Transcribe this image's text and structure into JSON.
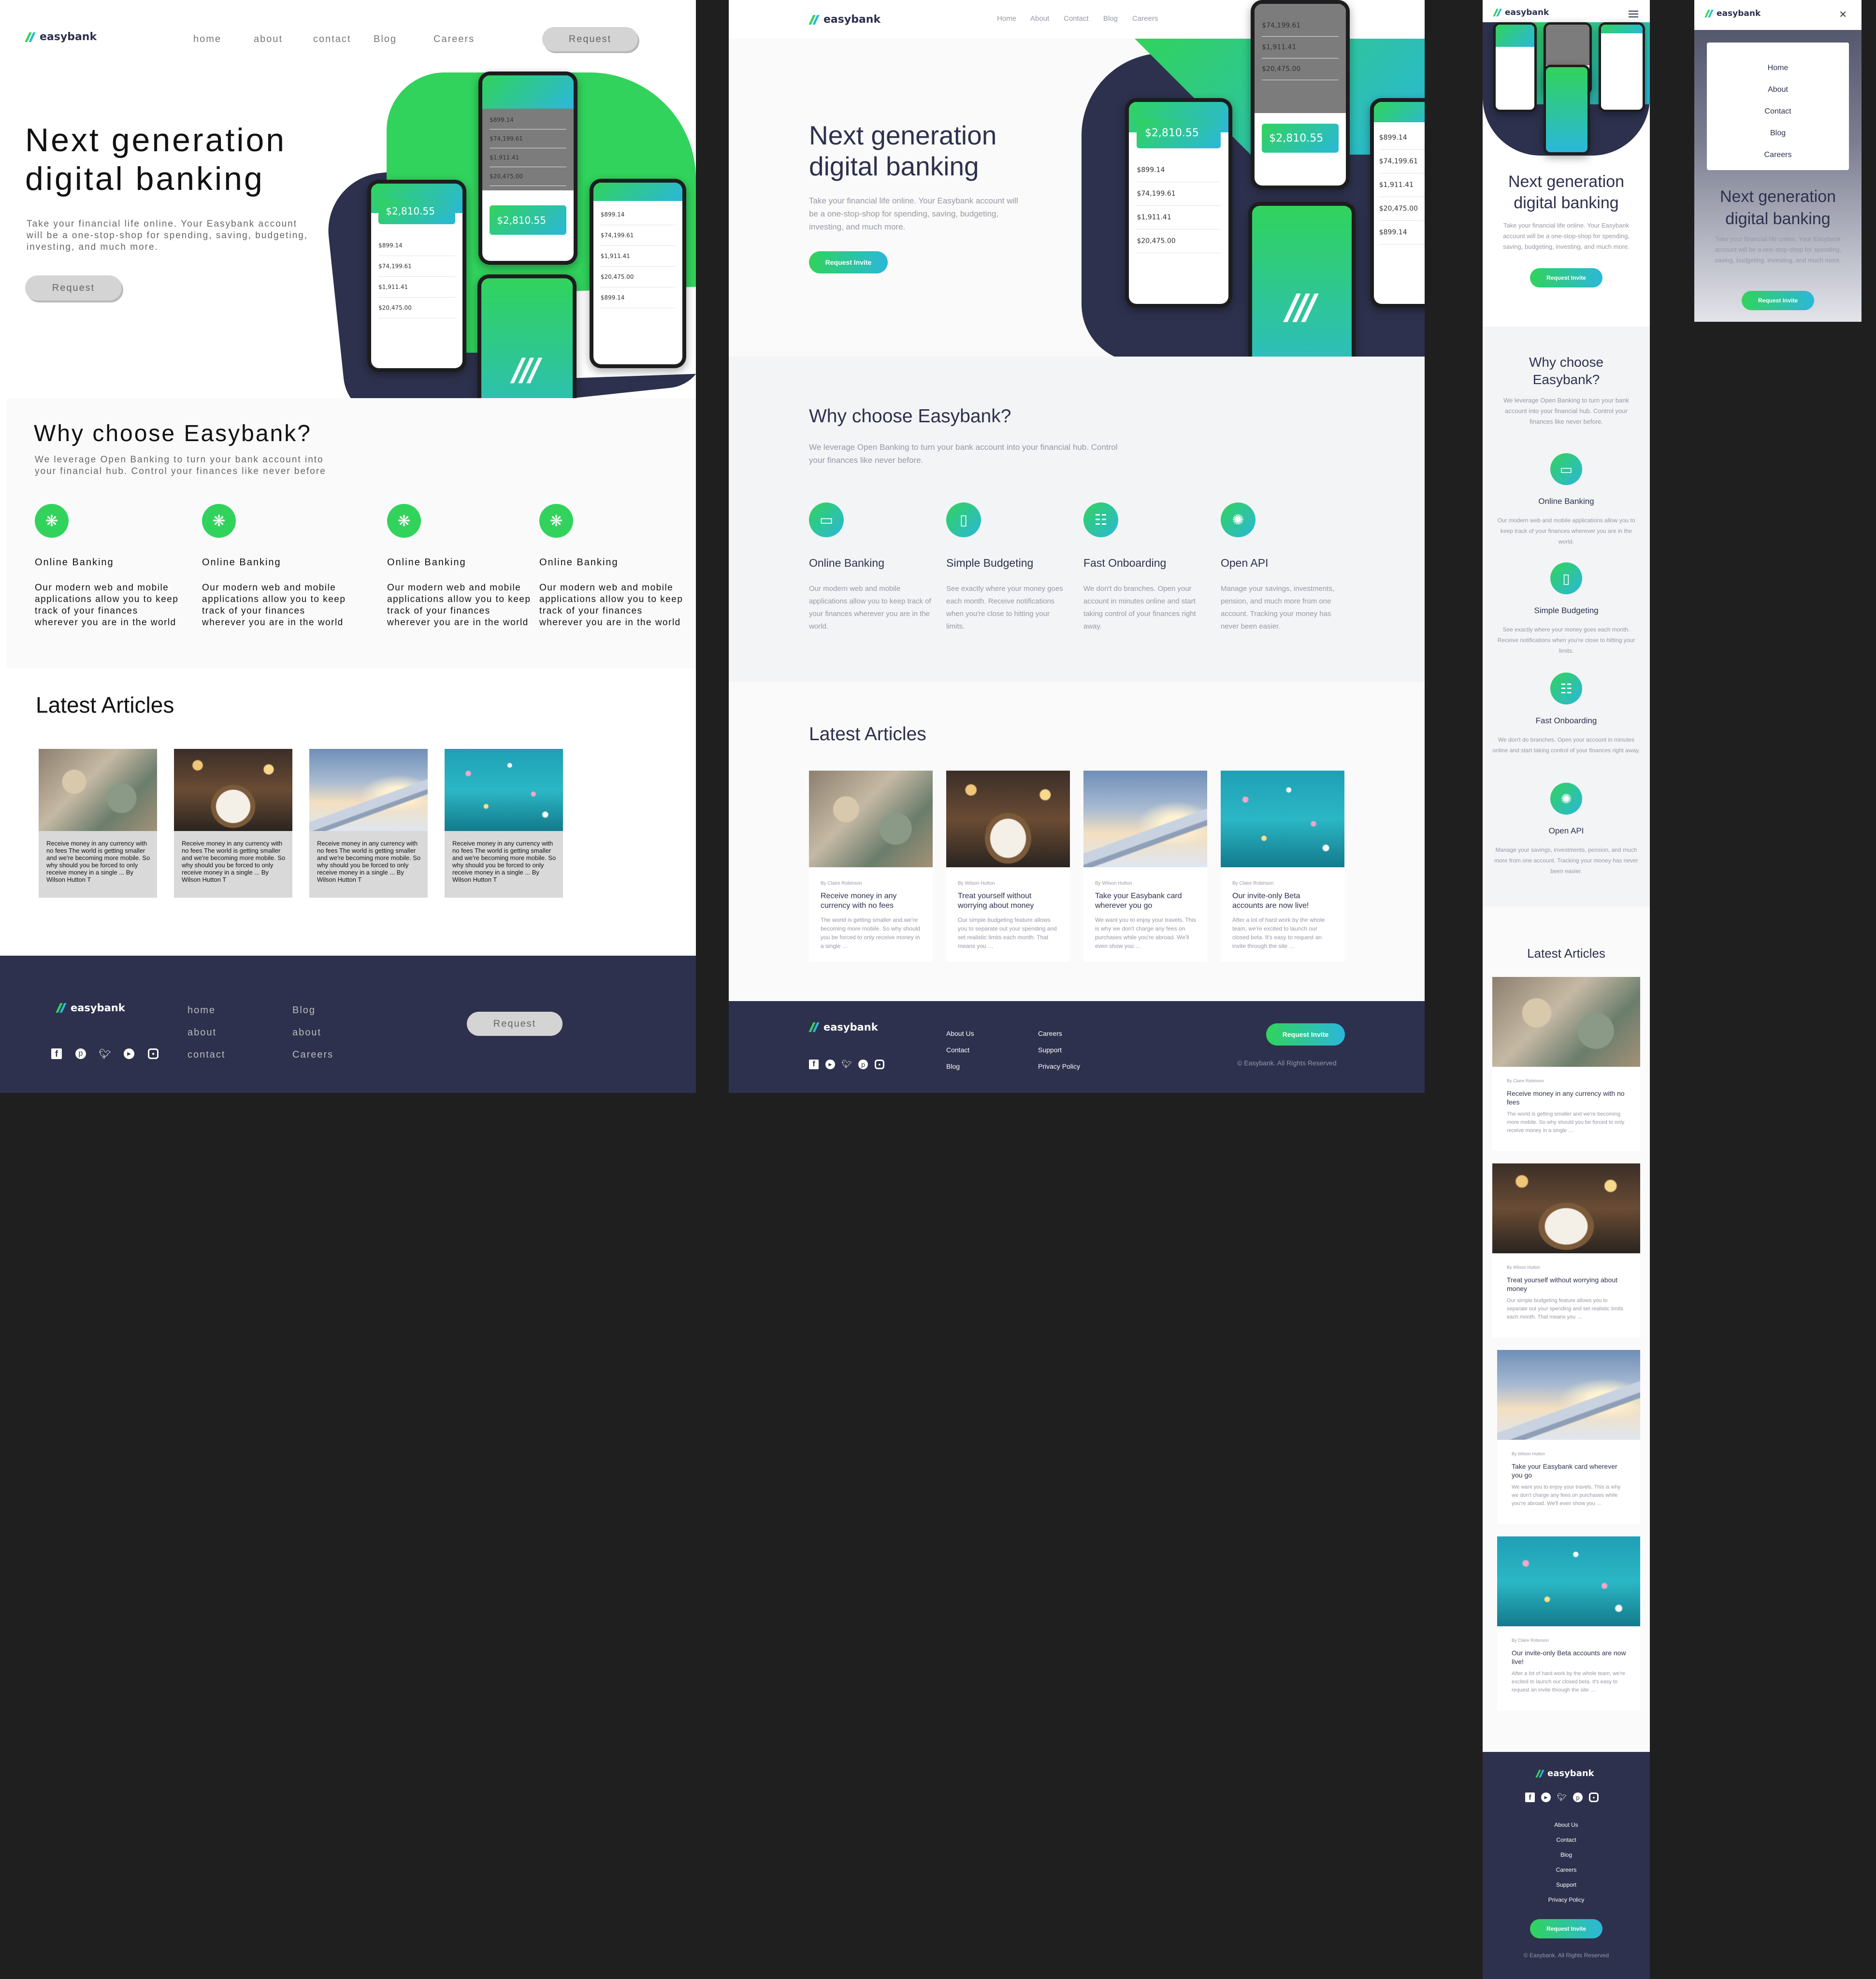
{
  "brand": "easybank",
  "hero": {
    "title_line1": "Next generation",
    "title_line2": "digital banking",
    "text_a": "Take your financial life online. Your Easybank account will be a one-stop-shop for spending, saving, budgeting, investing, and much more.",
    "text_b": "Take your financial life online. Your Easybank account will be a one-stop-shop for spending, saving, budgeting, investing, and much more."
  },
  "phone": {
    "balance": "$2,810.55",
    "rows": [
      "$899.14",
      "$74,199.61",
      "$1,911.41",
      "$20,475.00"
    ]
  },
  "why": {
    "title": "Why choose Easybank?",
    "title_a": "Why choose",
    "title_b": "Easybank?",
    "text": "We leverage Open Banking to turn your bank account into your financial hub. Control your finances like never before.",
    "text_1_l1": "We leverage Open Banking to turn your bank account into",
    "text_1_l2": "your financial hub. Control your finances like never before"
  },
  "features": [
    {
      "title": "Online Banking",
      "text": "Our modern web and mobile applications allow you to keep track of your finances wherever you are in the world."
    },
    {
      "title": "Simple Budgeting",
      "text": "See exactly where your money goes each month. Receive notifications when you're close to hitting your limits."
    },
    {
      "title": "Fast Onboarding",
      "text": "We don't do branches. Open your account in minutes online and start taking control of your finances right away."
    },
    {
      "title": "Open API",
      "text": "Manage your savings, investments, pension, and much more from one account. Tracking your money has never been easier."
    }
  ],
  "wire_feature": {
    "title": "Online Banking",
    "text": "Our modern web and mobile applications allow you to keep track of your finances wherever you are in the world"
  },
  "articles_title": "Latest Articles",
  "articles": [
    {
      "author": "By Claire Robinson",
      "title": "Receive money in any currency with no fees",
      "excerpt": "The world is getting smaller and we're becoming more mobile. So why should you be forced to only receive money in a single …"
    },
    {
      "author": "By Wilson Hutton",
      "title": "Treat yourself without worrying about money",
      "excerpt": "Our simple budgeting feature allows you to separate out your spending and set realistic limits each month. That means you …"
    },
    {
      "author": "By Wilson Hutton",
      "title": "Take your Easybank card wherever you go",
      "excerpt": "We want you to enjoy your travels. This is why we don't charge any fees on purchases while you're abroad. We'll even show you …"
    },
    {
      "author": "By Claire Robinson",
      "title": "Our invite-only Beta accounts are now live!",
      "excerpt": "After a lot of hard work by the whole team, we're excited to launch our closed beta. It's easy to request an invite through the site …"
    }
  ],
  "wire_article_caption": "Receive money in any currency with no fees The world is getting smaller and we're becoming more mobile. So why should you be forced to only receive money in a single ... By Wilson Hutton T",
  "nav_wire": {
    "home": "home",
    "about": "about",
    "contact": "contact",
    "blog": "Blog",
    "careers": "Careers",
    "request": "Request"
  },
  "nav": [
    "Home",
    "About",
    "Contact",
    "Blog",
    "Careers"
  ],
  "cta": "Request Invite",
  "footer": {
    "links_col1": [
      "About Us",
      "Contact",
      "Blog"
    ],
    "links_col2": [
      "Careers",
      "Support",
      "Privacy Policy"
    ],
    "copyright": "© Easybank. All Rights Reserved",
    "wire_col1": [
      "home",
      "about",
      "contact"
    ],
    "wire_col2": [
      "Blog",
      "about",
      "Careers"
    ]
  },
  "colors": {
    "dark_blue": "#2d314d",
    "lime_green": "#31d35c",
    "bright_cyan": "#2bb7da",
    "grayish_blue": "#9698a6",
    "light_grayish_blue": "#f3f4f6"
  },
  "icons": [
    "facebook-icon",
    "youtube-icon",
    "twitter-icon",
    "pinterest-icon",
    "instagram-icon",
    "hamburger-icon",
    "close-icon"
  ]
}
